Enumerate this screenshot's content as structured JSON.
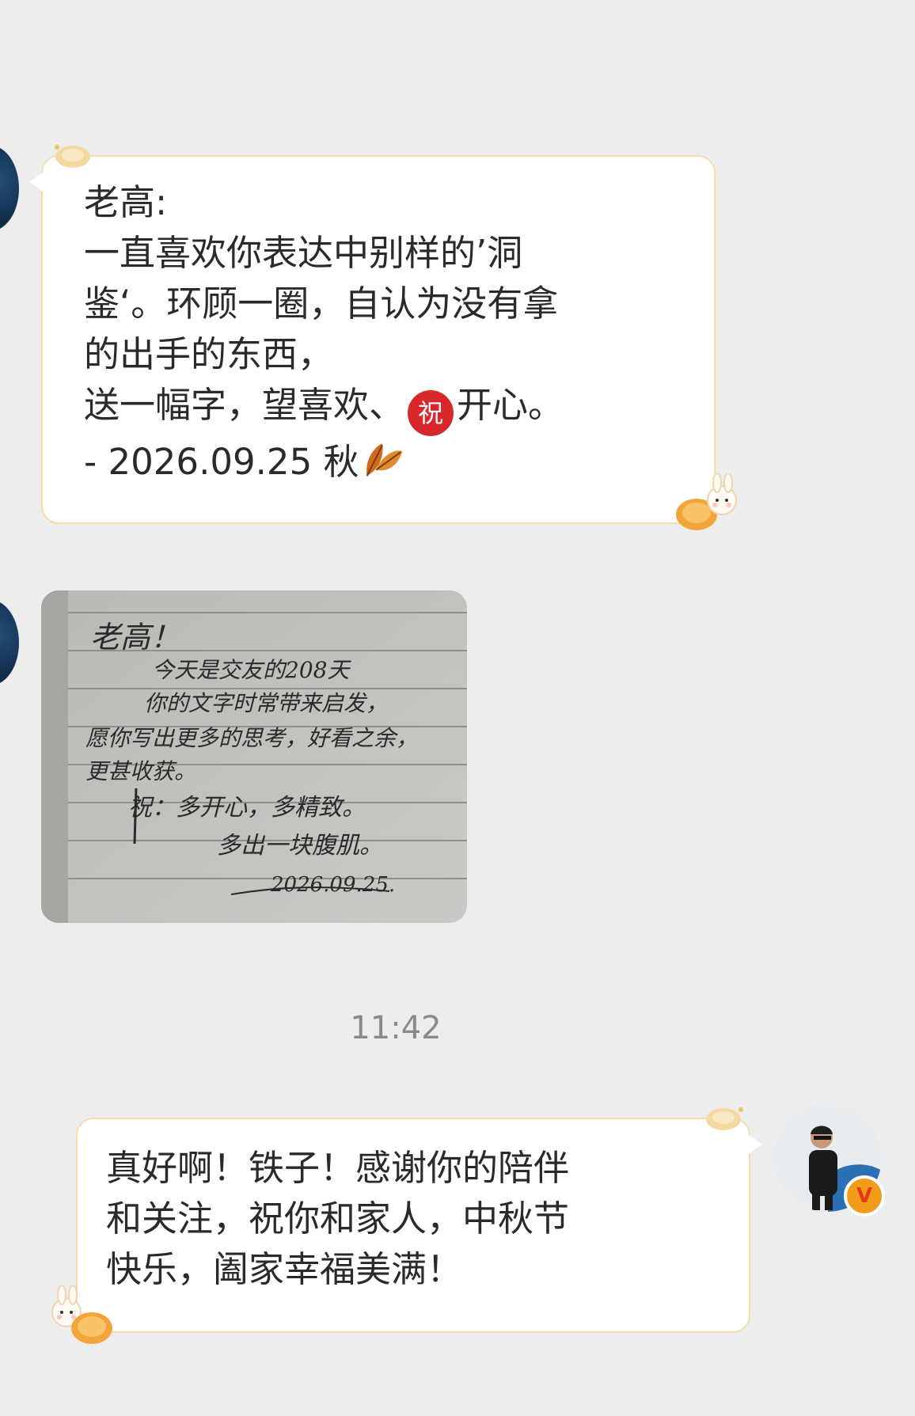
{
  "messages": {
    "incoming_text": {
      "lines": [
        "老高:",
        "一直喜欢你表达中别样的’洞",
        "鉴‘。环顾一圈，自认为没有拿",
        "的出手的东西，",
        "送一幅字，望喜欢、",
        "开心。",
        "- 2026.09.25 秋"
      ],
      "emoji_zhu": "祝"
    },
    "handwritten_note": {
      "lines": [
        "老高！",
        "今天是交友的208天",
        "你的文字时常带来启发，",
        "愿你写出更多的思考，好看之余，",
        "更甚收获。",
        "祝：多开心，多精致。",
        "多出一块腹肌。",
        "2026.09.25."
      ]
    },
    "timestamp": "11:42",
    "outgoing_text": {
      "lines": [
        "真好啊！铁子！感谢你的陪伴",
        "和关注，祝你和家人，中秋节",
        "快乐，阖家幸福美满！"
      ]
    }
  },
  "colors": {
    "background": "#ededed",
    "bubble": "#ffffff",
    "bubble_border": "#f4dcae",
    "emoji_red": "#d7272a",
    "timestamp": "#8a8a8a",
    "verified_badge": "#f29c1a"
  },
  "icons": [
    "moon-cake-bunny-icon",
    "autumn-leaf-icon",
    "verified-v-badge-icon"
  ]
}
